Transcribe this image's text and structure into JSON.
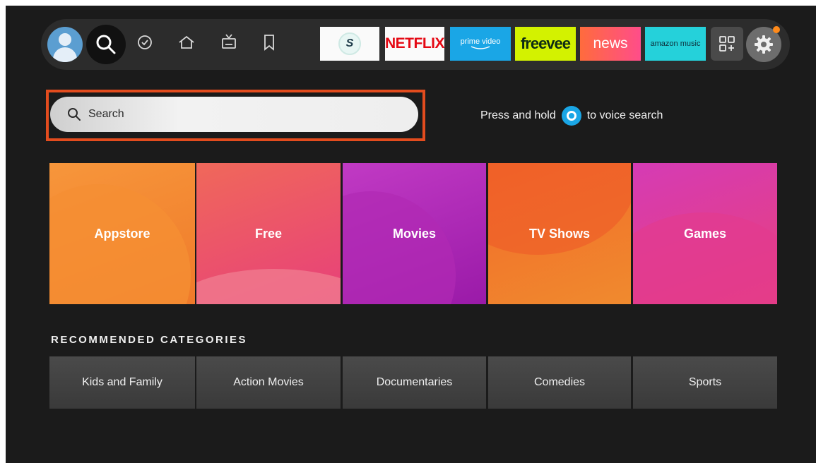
{
  "nav": {
    "icons": [
      "profile-avatar",
      "search-icon",
      "check-circle-icon",
      "home-icon",
      "live-tv-icon",
      "bookmark-icon"
    ],
    "apps": [
      {
        "name": "Surfshark",
        "label": "S"
      },
      {
        "name": "Netflix",
        "label": "NETFLIX"
      },
      {
        "name": "Prime Video",
        "label": "prime video"
      },
      {
        "name": "Freevee",
        "label": "freevee"
      },
      {
        "name": "News",
        "label": "news"
      },
      {
        "name": "Amazon Music",
        "label": "amazon music"
      }
    ],
    "apps_icon": "apps-grid-icon",
    "settings_icon": "gear-icon"
  },
  "search": {
    "placeholder": "Search",
    "voice_hint_before": "Press and hold",
    "voice_hint_after": "to voice search"
  },
  "categories": [
    "Appstore",
    "Free",
    "Movies",
    "TV Shows",
    "Games"
  ],
  "recommended": {
    "title": "RECOMMENDED CATEGORIES",
    "items": [
      "Kids and Family",
      "Action Movies",
      "Documentaries",
      "Comedies",
      "Sports"
    ]
  },
  "colors": {
    "highlight": "#e34c1e",
    "alexa": "#1aa6e6",
    "notification": "#ff8a1a"
  }
}
